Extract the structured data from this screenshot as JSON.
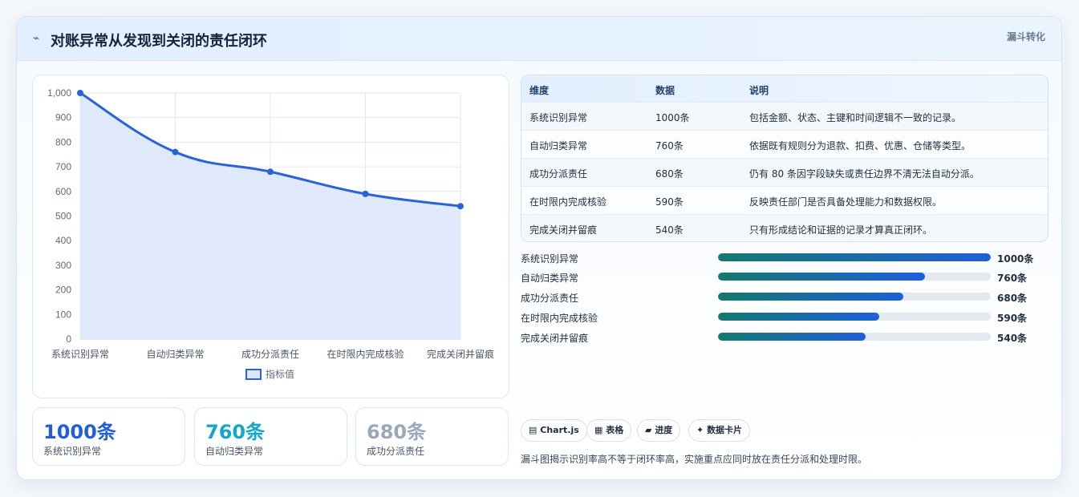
{
  "header": {
    "icon": "zigzag-icon",
    "title": "对账异常从发现到关闭的责任闭环",
    "badge": "漏斗转化"
  },
  "chart_data": {
    "type": "area",
    "categories": [
      "系统识别异常",
      "自动归类异常",
      "成功分派责任",
      "在时限内完成核验",
      "完成关闭并留痕"
    ],
    "series": [
      {
        "name": "指标值",
        "values": [
          1000,
          760,
          680,
          590,
          540
        ]
      }
    ],
    "ylim": [
      0,
      1000
    ],
    "yticks": [
      "0",
      "100",
      "200",
      "300",
      "400",
      "500",
      "600",
      "700",
      "800",
      "900",
      "1,000"
    ],
    "legend": "bottom",
    "grid": true,
    "line_color": "#2a62d8",
    "fill_color": "#dde7fa"
  },
  "stats": [
    {
      "value": "1000条",
      "label": "系统识别异常",
      "color": "#1f5fd8"
    },
    {
      "value": "760条",
      "label": "自动归类异常",
      "color": "#12a9c4"
    },
    {
      "value": "680条",
      "label": "成功分派责任",
      "color": "#9aa8bc"
    }
  ],
  "table": {
    "headers": [
      "维度",
      "数据",
      "说明"
    ],
    "rows": [
      [
        "系统识别异常",
        "1000条",
        "包括金额、状态、主键和时间逻辑不一致的记录。"
      ],
      [
        "自动归类异常",
        "760条",
        "依据既有规则分为退款、扣费、优惠、仓储等类型。"
      ],
      [
        "成功分派责任",
        "680条",
        "仍有 80 条因字段缺失或责任边界不清无法自动分派。"
      ],
      [
        "在时限内完成核验",
        "590条",
        "反映责任部门是否具备处理能力和数据权限。"
      ],
      [
        "完成关闭并留痕",
        "540条",
        "只有形成结论和证据的记录才算真正闭环。"
      ]
    ]
  },
  "bars": [
    {
      "label": "系统识别异常",
      "value": "1000条",
      "fraction": 1.0
    },
    {
      "label": "自动归类异常",
      "value": "760条",
      "fraction": 0.76
    },
    {
      "label": "成功分派责任",
      "value": "680条",
      "fraction": 0.68
    },
    {
      "label": "在时限内完成核验",
      "value": "590条",
      "fraction": 0.59
    },
    {
      "label": "完成关闭并留痕",
      "value": "540条",
      "fraction": 0.54
    }
  ],
  "chips": [
    {
      "icon": "chart-icon",
      "glyph": "▤",
      "label": "Chart.js"
    },
    {
      "icon": "table-icon",
      "glyph": "▦",
      "label": "表格"
    },
    {
      "icon": "progress-icon",
      "glyph": "▰",
      "label": "进度"
    },
    {
      "icon": "sparkle-icon",
      "glyph": "✦",
      "label": "数据卡片"
    }
  ],
  "footnote": "漏斗图揭示识别率高不等于闭环率高，实施重点应同时放在责任分派和处理时限。"
}
